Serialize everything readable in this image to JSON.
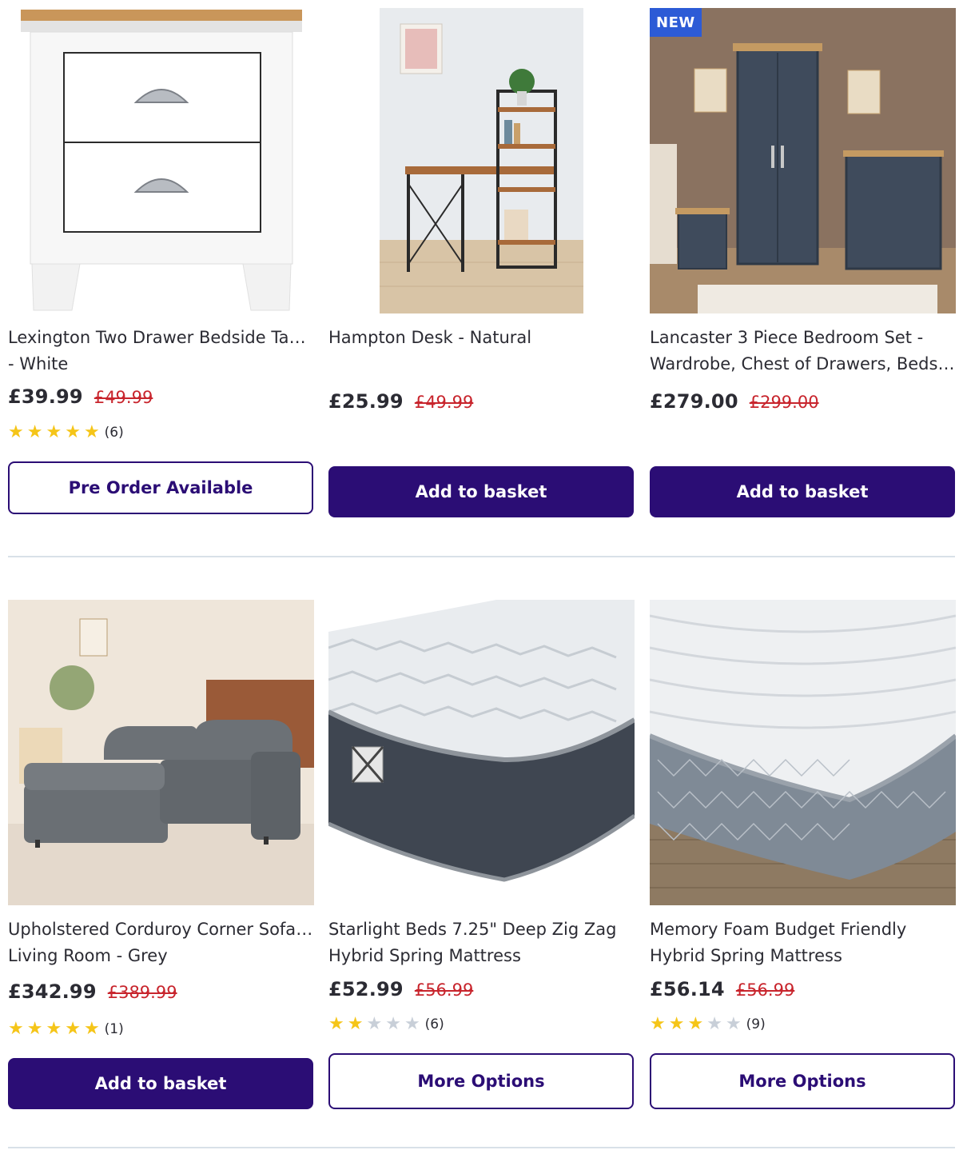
{
  "products": [
    {
      "title_lines": [
        "Lexington Two Drawer Bedside Table",
        "- White"
      ],
      "price": "£39.99",
      "was_price": "£49.99",
      "rating": 5,
      "review_count": "(6)",
      "button_label": "Pre Order Available",
      "button_style": "outline",
      "badge": "",
      "image_icon": "bedside-table-image"
    },
    {
      "title_lines": [
        "Hampton Desk - Natural"
      ],
      "price": "£25.99",
      "was_price": "£49.99",
      "rating": null,
      "review_count": "",
      "button_label": "Add to basket",
      "button_style": "solid",
      "badge": "",
      "image_icon": "desk-image"
    },
    {
      "title_lines": [
        "Lancaster 3 Piece Bedroom Set -",
        "Wardrobe, Chest of Drawers, Bedsid..."
      ],
      "price": "£279.00",
      "was_price": "£299.00",
      "rating": null,
      "review_count": "",
      "button_label": "Add to basket",
      "button_style": "solid",
      "badge": "NEW",
      "image_icon": "bedroom-set-image"
    },
    {
      "title_lines": [
        "Upholstered Corduroy Corner Sofa for",
        "Living Room - Grey"
      ],
      "price": "£342.99",
      "was_price": "£389.99",
      "rating": 5,
      "review_count": "(1)",
      "button_label": "Add to basket",
      "button_style": "solid",
      "badge": "",
      "image_icon": "corner-sofa-image"
    },
    {
      "title_lines": [
        "Starlight Beds 7.25\" Deep Zig Zag",
        "Hybrid Spring Mattress"
      ],
      "price": "£52.99",
      "was_price": "£56.99",
      "rating": 2,
      "review_count": "(6)",
      "button_label": "More Options",
      "button_style": "outline",
      "badge": "",
      "image_icon": "zigzag-mattress-image"
    },
    {
      "title_lines": [
        "Memory Foam Budget Friendly",
        "Hybrid Spring Mattress"
      ],
      "price": "£56.14",
      "was_price": "£56.99",
      "rating": 3,
      "review_count": "(9)",
      "button_label": "More Options",
      "button_style": "outline",
      "badge": "",
      "image_icon": "memory-foam-mattress-image"
    }
  ],
  "colors": {
    "primary_button": "#2b0d75",
    "sale_price": "#c8252d",
    "star": "#f5c518",
    "badge": "#2c5bd6"
  }
}
